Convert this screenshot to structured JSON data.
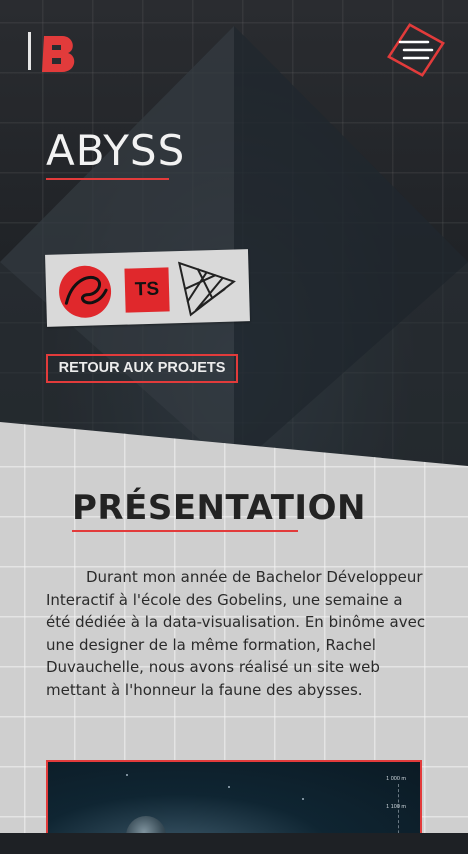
{
  "header": {
    "logo_text": "lB",
    "menu_icon": "hamburger-icon"
  },
  "project": {
    "title": "ABYSS",
    "technologies": [
      {
        "name": "Sass",
        "icon": "sass-icon"
      },
      {
        "name": "TS",
        "icon": "typescript-icon"
      },
      {
        "name": "triangle-mesh",
        "icon": "triangle-mesh-icon"
      }
    ],
    "back_label": "RETOUR AUX PROJETS"
  },
  "presentation": {
    "heading": "PRÉSENTATION",
    "text": "Durant mon année de Bachelor Développeur Interactif à l'école des Gobelins, une semaine a été dédiée à la data-visualisation. En binôme avec une designer de la même formation, Rachel Duvauchelle, nous avons réalisé un site web mettant à l'honneur la faune des abysses."
  },
  "preview": {
    "depth_labels": [
      "1 000 m",
      "1 100 m"
    ]
  },
  "colors": {
    "accent": "#e23b3b",
    "dark_bg": "#1f2226",
    "light_bg": "#cfcfcf"
  }
}
